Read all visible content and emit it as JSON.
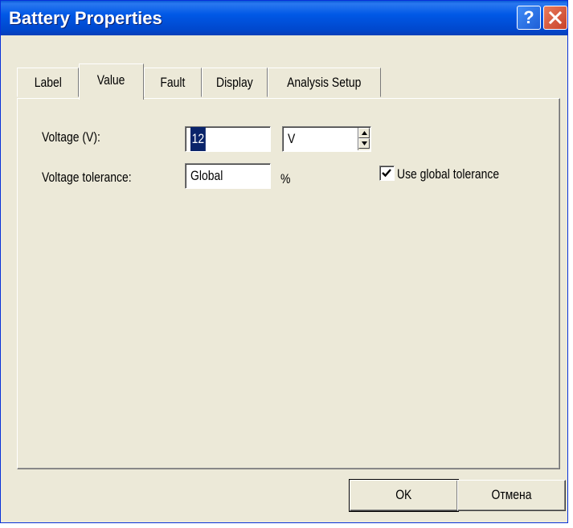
{
  "window": {
    "title": "Battery Properties",
    "help_glyph": "?"
  },
  "tabs": [
    {
      "label": "Label"
    },
    {
      "label": "Value"
    },
    {
      "label": "Fault"
    },
    {
      "label": "Display"
    },
    {
      "label": "Analysis Setup"
    }
  ],
  "active_tab": "Value",
  "form": {
    "voltage_label": "Voltage (V):",
    "voltage_value": "12",
    "voltage_unit": "V",
    "tolerance_label": "Voltage tolerance:",
    "tolerance_value": "Global",
    "tolerance_unit": "%",
    "use_global_label": "Use global tolerance",
    "use_global_checked": true
  },
  "buttons": {
    "ok": "OK",
    "cancel": "Отмена"
  },
  "colors": {
    "titlebar": "#0058e6",
    "dialog_bg": "#ece9d8",
    "selection": "#0a246a",
    "close_button": "#d1482c"
  },
  "icons": [
    "help-icon",
    "close-icon",
    "spin-up-icon",
    "spin-down-icon",
    "checkmark-icon"
  ]
}
